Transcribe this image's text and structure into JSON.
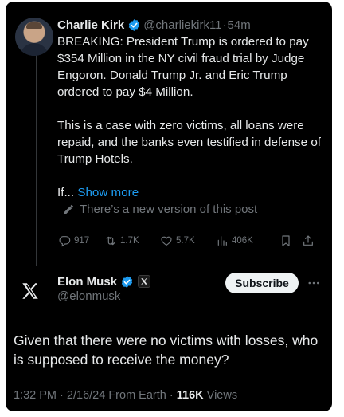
{
  "post1": {
    "author_name": "Charlie Kirk",
    "author_handle": "@charliekirk11",
    "separator": "·",
    "time_ago": "54m",
    "paragraph1": "BREAKING: President Trump is ordered to pay $354 Million in the NY civil fraud trial by Judge Engoron. Donald Trump Jr. and Eric Trump ordered to pay $4 Million.",
    "paragraph2": "This is a case with zero victims, all loans were repaid, and the banks even testified in defense of Trump Hotels.",
    "truncated_text": "If...",
    "show_more_label": "Show more",
    "edited_notice": "There’s a new version of this post",
    "replies": "917",
    "reposts": "1.7K",
    "likes": "5.7K",
    "views": "406K"
  },
  "post2": {
    "author_name": "Elon Musk",
    "author_handle": "@elonmusk",
    "subscribe_label": "Subscribe",
    "text": "Given that there were no victims with losses, who is supposed to receive the money?",
    "time": "1:32 PM",
    "date": "2/16/24",
    "source": "From Earth",
    "dot": "·",
    "view_count": "116K",
    "views_label": "Views"
  },
  "colors": {
    "background": "#000000",
    "text": "#e7e9ea",
    "muted": "#71767b",
    "link": "#1d9bf0",
    "verified": "#1d9bf0"
  },
  "icons": {
    "verified": "verified-badge-icon",
    "edit": "pencil-icon",
    "reply": "reply-icon",
    "repost": "repost-icon",
    "like": "heart-icon",
    "views": "bar-chart-icon",
    "bookmark": "bookmark-icon",
    "share": "share-icon",
    "more": "more-icon",
    "x_logo": "x-logo-icon"
  }
}
